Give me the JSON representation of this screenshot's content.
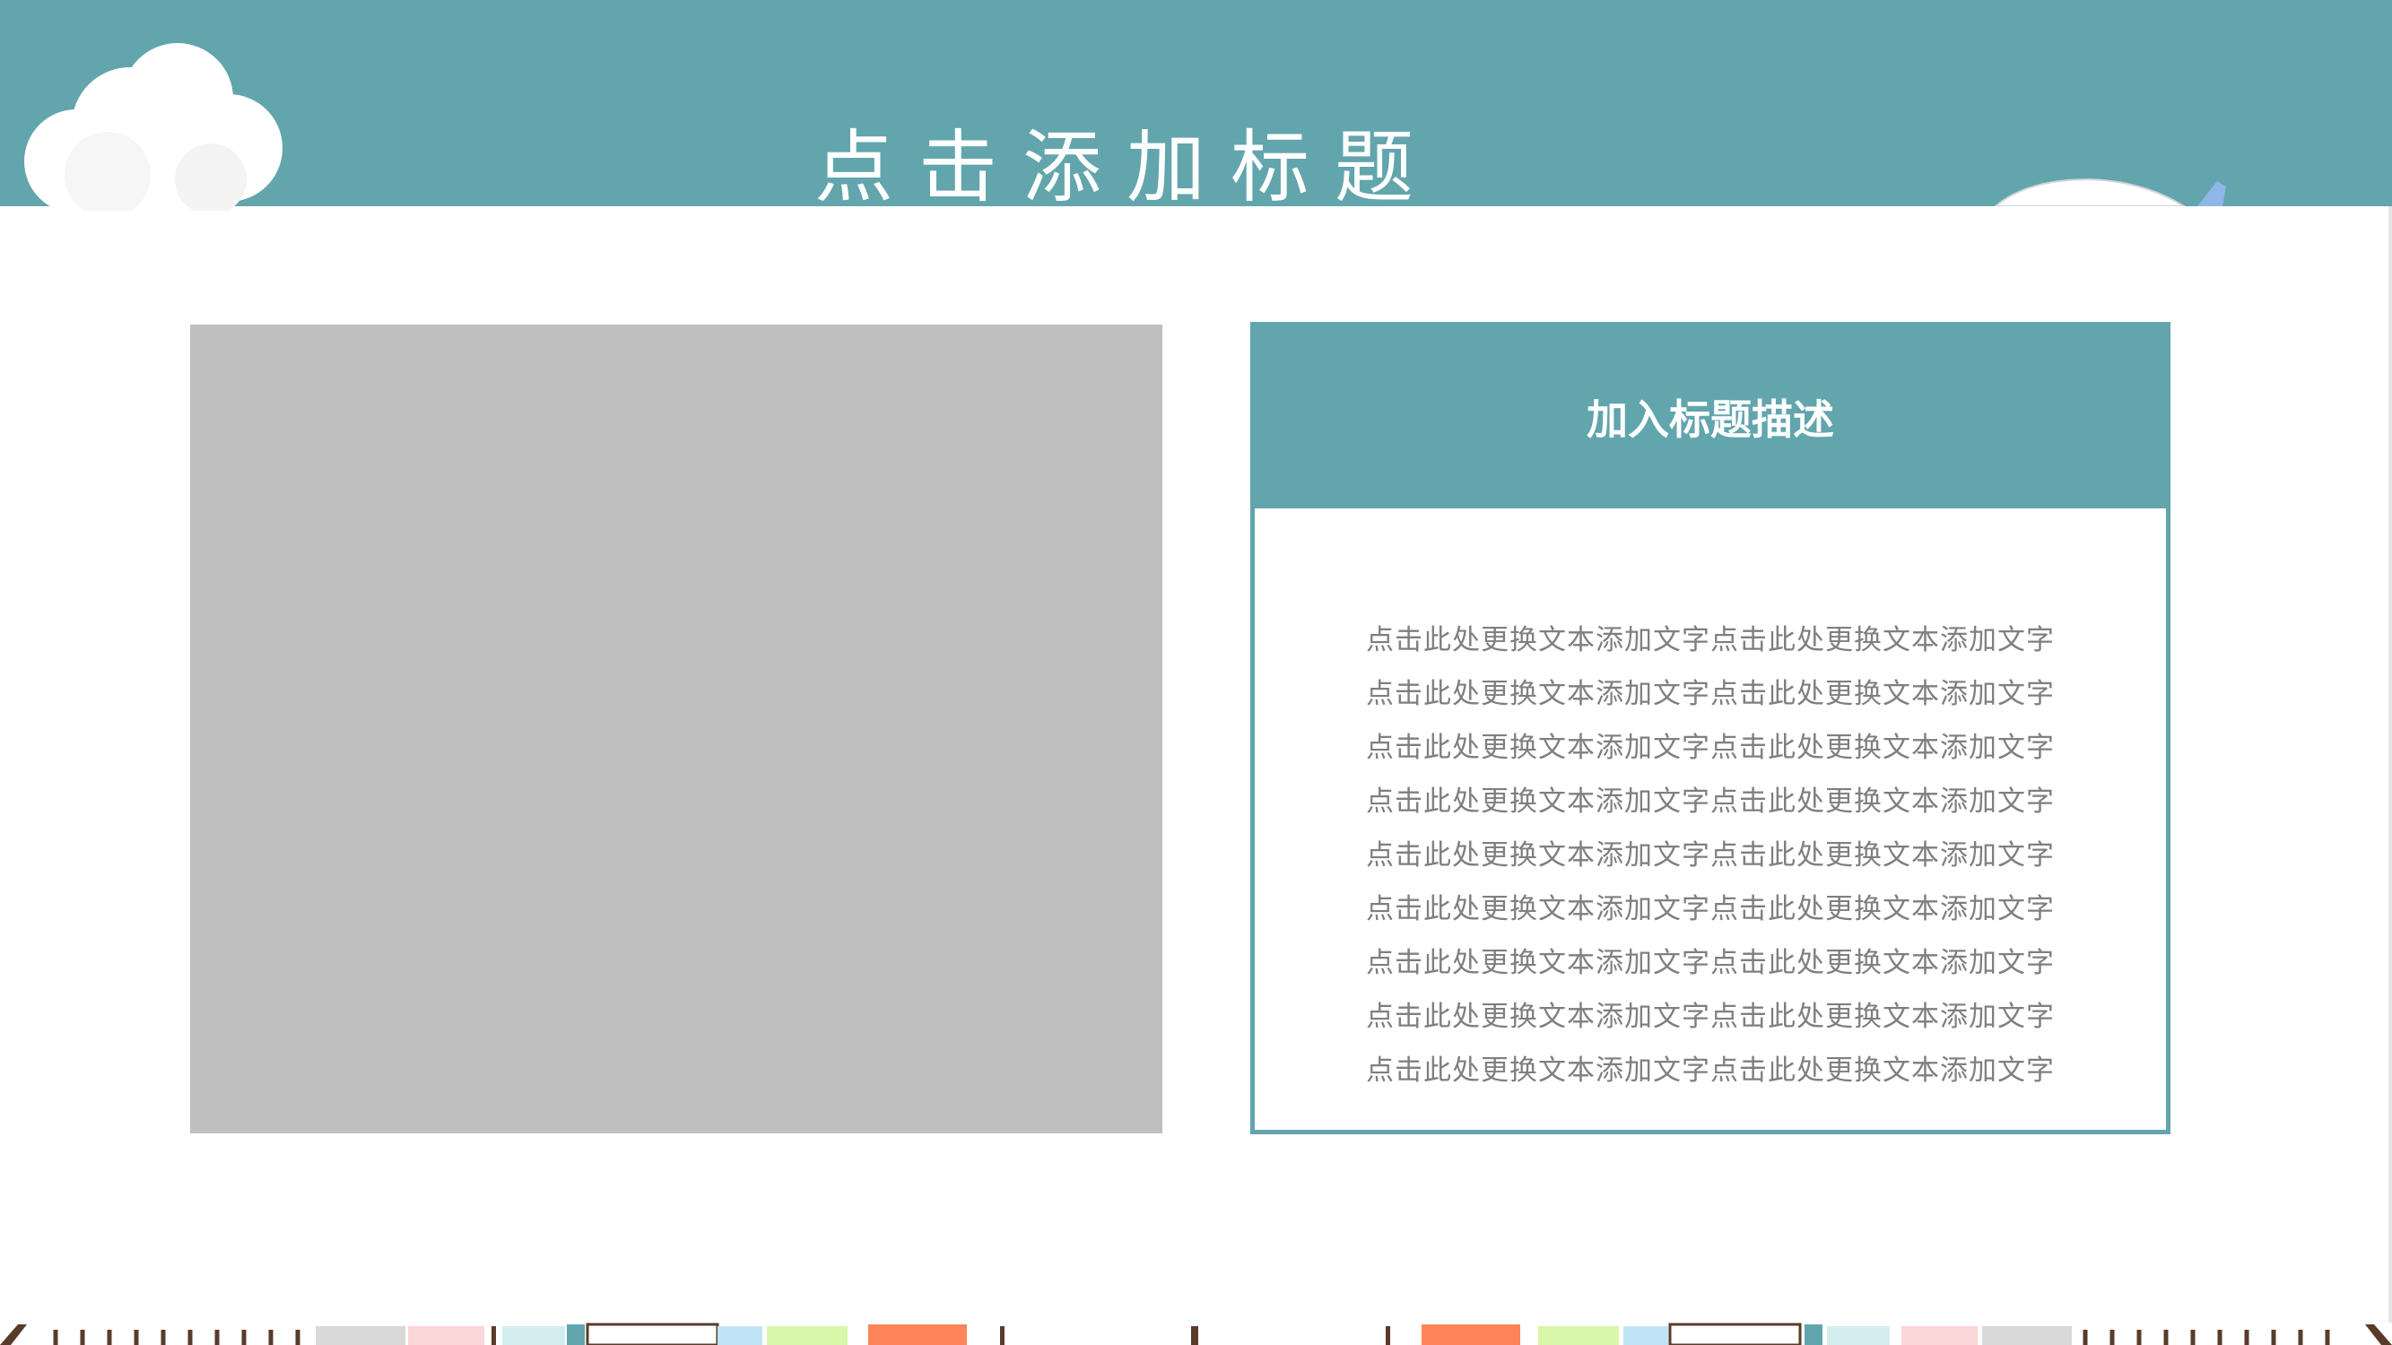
{
  "page": {
    "title": "点击添加标题"
  },
  "card": {
    "title": "加入标题描述",
    "lines": [
      "点击此处更换文本添加文字点击此处更换文本添加文字",
      "点击此处更换文本添加文字点击此处更换文本添加文字",
      "点击此处更换文本添加文字点击此处更换文本添加文字",
      "点击此处更换文本添加文字点击此处更换文本添加文字",
      "点击此处更换文本添加文字点击此处更换文本添加文字",
      "点击此处更换文本添加文字点击此处更换文本添加文字",
      "点击此处更换文本添加文字点击此处更换文本添加文字",
      "点击此处更换文本添加文字点击此处更换文本添加文字",
      "点击此处更换文本添加文字点击此处更换文本添加文字"
    ]
  },
  "colors": {
    "accent": "#62a5ad",
    "placeholder": "#bfbfbf",
    "body_text": "#7f7f7f",
    "background": "#ffffff"
  },
  "icons": {
    "header_left": "cloud-icon",
    "header_right": "airplane-icon",
    "footer": "building-strip-icon"
  }
}
